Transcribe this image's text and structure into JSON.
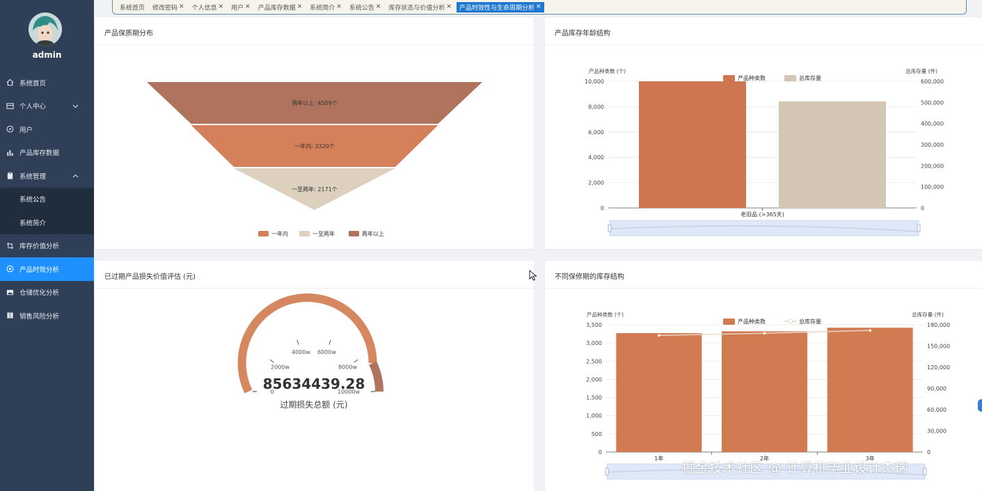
{
  "sidebar": {
    "username": "admin",
    "items": [
      {
        "label": "系统首页",
        "icon": "home-icon"
      },
      {
        "label": "个人中心",
        "icon": "id-card-icon",
        "expandable": true
      },
      {
        "label": "用户",
        "icon": "compass-icon"
      },
      {
        "label": "产品库存数据",
        "icon": "bar-chart-icon"
      },
      {
        "label": "系统管理",
        "icon": "clipboard-icon",
        "expanded": true
      },
      {
        "label": "系统公告",
        "sub": true
      },
      {
        "label": "系统简介",
        "sub": true
      },
      {
        "label": "库存价值分析",
        "icon": "crop-icon"
      },
      {
        "label": "产品时效分析",
        "icon": "settings-icon",
        "active": true
      },
      {
        "label": "仓储优化分析",
        "icon": "picture-icon"
      },
      {
        "label": "销售风险分析",
        "icon": "book-icon"
      }
    ]
  },
  "tabs": [
    {
      "label": "系统首页",
      "closable": false
    },
    {
      "label": "修改密码",
      "closable": true
    },
    {
      "label": "个人信息",
      "closable": true
    },
    {
      "label": "用户",
      "closable": true
    },
    {
      "label": "产品库存数据",
      "closable": true
    },
    {
      "label": "系统简介",
      "closable": true
    },
    {
      "label": "系统公告",
      "closable": true
    },
    {
      "label": "库存状态与价值分析",
      "closable": true
    },
    {
      "label": "产品时效性与生命周期分析",
      "closable": true,
      "active": true
    }
  ],
  "colors": {
    "accent": "#1e90ff",
    "sidebar": "#2e3f57",
    "orange": "#d4805a",
    "beige": "#d8c9b4",
    "brown": "#b0735e"
  },
  "cards": {
    "shelf_life": {
      "title": "产品保质期分布"
    },
    "age_structure": {
      "title": "产品库存年龄结构"
    },
    "expired_loss": {
      "title": "已过期产品损失价值评估 (元)"
    },
    "warranty_structure": {
      "title": "不同保修期的库存结构"
    }
  },
  "chart_data": [
    {
      "type": "funnel",
      "data": [
        {
          "name": "两年以上",
          "value": 4509,
          "label": "两年以上: 4509个",
          "color": "#b0735e"
        },
        {
          "name": "一年内",
          "value": 3320,
          "label": "一年内: 3320个",
          "color": "#d4805a"
        },
        {
          "name": "一至两年",
          "value": 2171,
          "label": "一至两年: 2171个",
          "color": "#ddd0bf"
        }
      ],
      "legend": [
        "一年内",
        "一至两年",
        "两年以上"
      ],
      "legend_position": "bottom"
    },
    {
      "type": "bar",
      "categories": [
        "老旧品 (>365天)"
      ],
      "series": [
        {
          "name": "产品种类数",
          "values": [
            10000
          ],
          "axis": "left",
          "color": "#cd7650"
        },
        {
          "name": "总库存量",
          "values": [
            505000
          ],
          "axis": "right",
          "color": "#d4c6b4"
        }
      ],
      "ylabel_left": "产品种类数 (个)",
      "ylabel_right": "总库存量 (件)",
      "yticks_left": [
        "0",
        "2,000",
        "4,000",
        "6,000",
        "8,000",
        "10,000"
      ],
      "yticks_right": [
        "0",
        "100,000",
        "200,000",
        "300,000",
        "400,000",
        "500,000",
        "600,000"
      ],
      "ylim_left": [
        0,
        10000
      ],
      "ylim_right": [
        0,
        600000
      ],
      "legend_position": "top",
      "grid": true
    },
    {
      "type": "gauge",
      "value": 85634439.28,
      "value_text": "85634439.28",
      "caption": "过期损失总额 (元)",
      "ticks": [
        "0",
        "2000w",
        "4000w",
        "6000w",
        "8000w",
        "10000w"
      ],
      "range": [
        0,
        10000
      ]
    },
    {
      "type": "bar",
      "categories": [
        "1年",
        "2年",
        "3年"
      ],
      "category_labels_visible": [
        "1年",
        "2年",
        "3年"
      ],
      "series": [
        {
          "name": "产品种类数",
          "type": "bar",
          "values": [
            3270,
            3320,
            3420
          ],
          "axis": "left",
          "color": "#d27a52"
        },
        {
          "name": "总库存量",
          "type": "line",
          "values": [
            165000,
            168000,
            172000
          ],
          "axis": "right",
          "color": "#e5d8c5"
        }
      ],
      "ylabel_left": "产品种类数 (个)",
      "ylabel_right": "总库存量 (件)",
      "yticks_left": [
        "0",
        "500",
        "1,000",
        "1,500",
        "2,000",
        "2,500",
        "3,000",
        "3,500"
      ],
      "yticks_right": [
        "0",
        "30,000",
        "60,000",
        "90,000",
        "120,000",
        "150,000",
        "180,000"
      ],
      "ylim_left": [
        0,
        3500
      ],
      "ylim_right": [
        0,
        180000
      ],
      "legend_position": "top",
      "grid": true
    }
  ],
  "watermark": "掘金技术社区 @ 计算机毕业设计杰瑞"
}
